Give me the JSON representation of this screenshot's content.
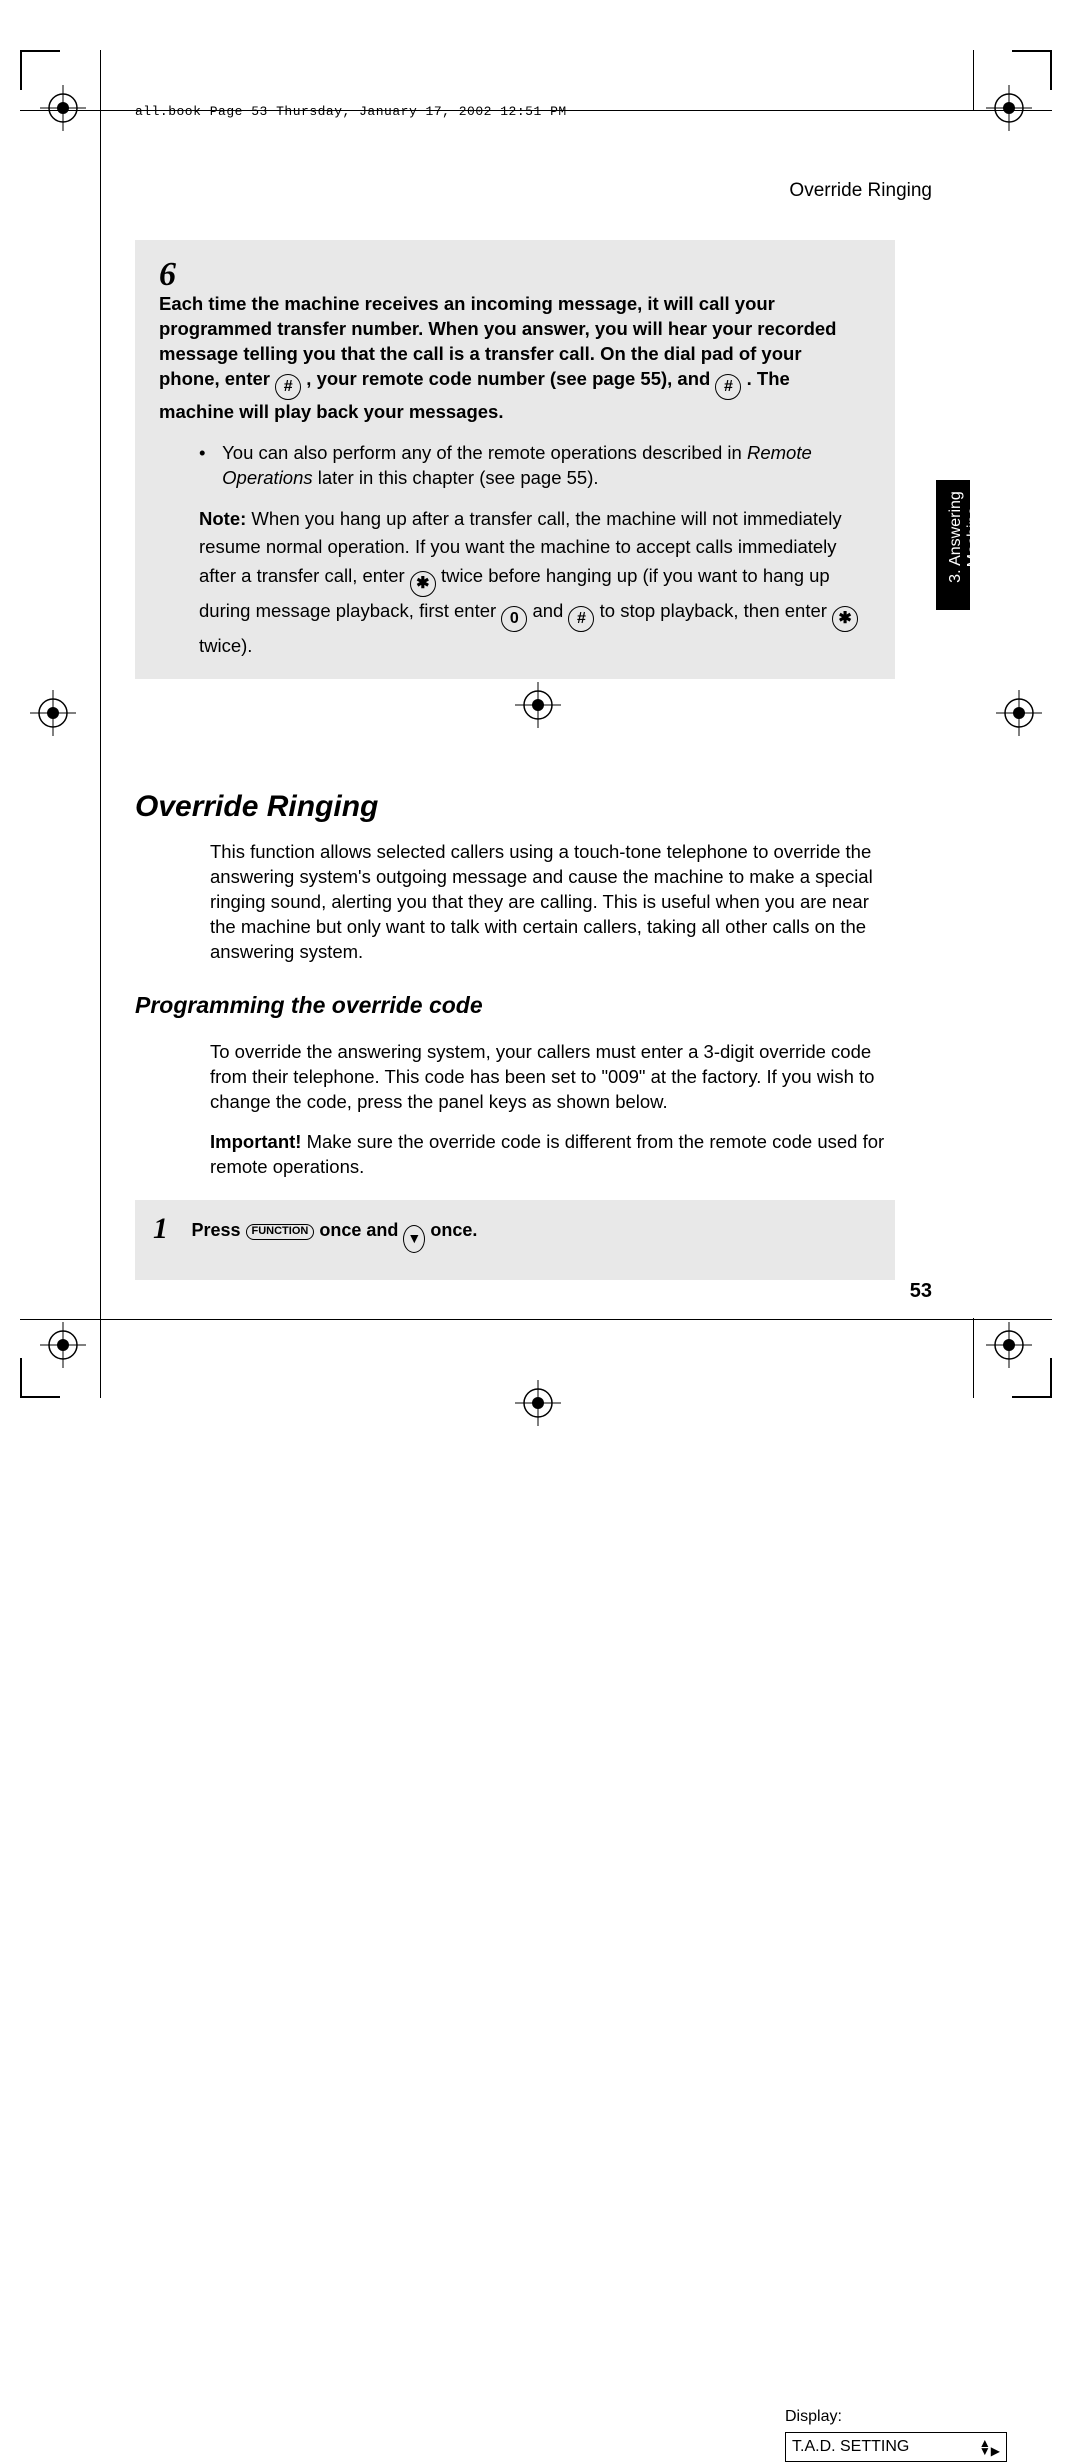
{
  "header": {
    "crop_line": "all.book  Page 53  Thursday, January 17, 2002  12:51 PM",
    "running_head": "Override Ringing"
  },
  "step6": {
    "num": "6",
    "body_line1": "Each time the machine receives an incoming message, it will call your programmed transfer number. When you answer, you will hear your recorded message telling you that the call is a transfer call. On the dial pad of your phone, enter ",
    "body_line2": ", your remote code number (see page 55), and ",
    "body_line3": ". The machine will play back your messages.",
    "bullet_pre": "You can also perform any of the remote operations described in ",
    "bullet_italic": "Remote Operations",
    "bullet_post": " later in this chapter (see page 55).",
    "note_label": "Note:",
    "note_1": " When you hang up after a transfer call, the machine will not immediately resume normal operation. If you want the machine to accept calls immediately after a transfer call, enter ",
    "note_2": " twice before hanging up (if you want to hang up during message playback, first enter ",
    "note_3": " and ",
    "note_4": " to stop playback, then enter ",
    "note_5": " twice)."
  },
  "keys": {
    "hash": "#",
    "star": "✱",
    "zero": "0"
  },
  "side_tab": {
    "line1": "3. Answering",
    "line2": "Machine"
  },
  "section": {
    "h1": "Override Ringing",
    "para1": "This function allows selected callers using a touch-tone telephone to override the answering system's outgoing message and cause the machine to make a special ringing sound, alerting you that they are calling. This is useful when you are near the machine but only want to talk with certain callers, taking all other calls on the answering system.",
    "h2": "Programming the override code",
    "para2": "To override the answering system, your callers must enter a 3-digit override code from their telephone. This code has been set to \"009\" at the factory. If you wish to change the code, press the panel keys as shown below.",
    "para3_b": "Important!",
    "para3": " Make sure the override code is different from the remote code used for remote operations."
  },
  "step1": {
    "num": "1",
    "pre": "Press ",
    "func": "FUNCTION",
    "mid": " once and ",
    "post": " once.",
    "display_label": "Display:",
    "display_value": "T.A.D. SETTING"
  },
  "page_number": "53"
}
